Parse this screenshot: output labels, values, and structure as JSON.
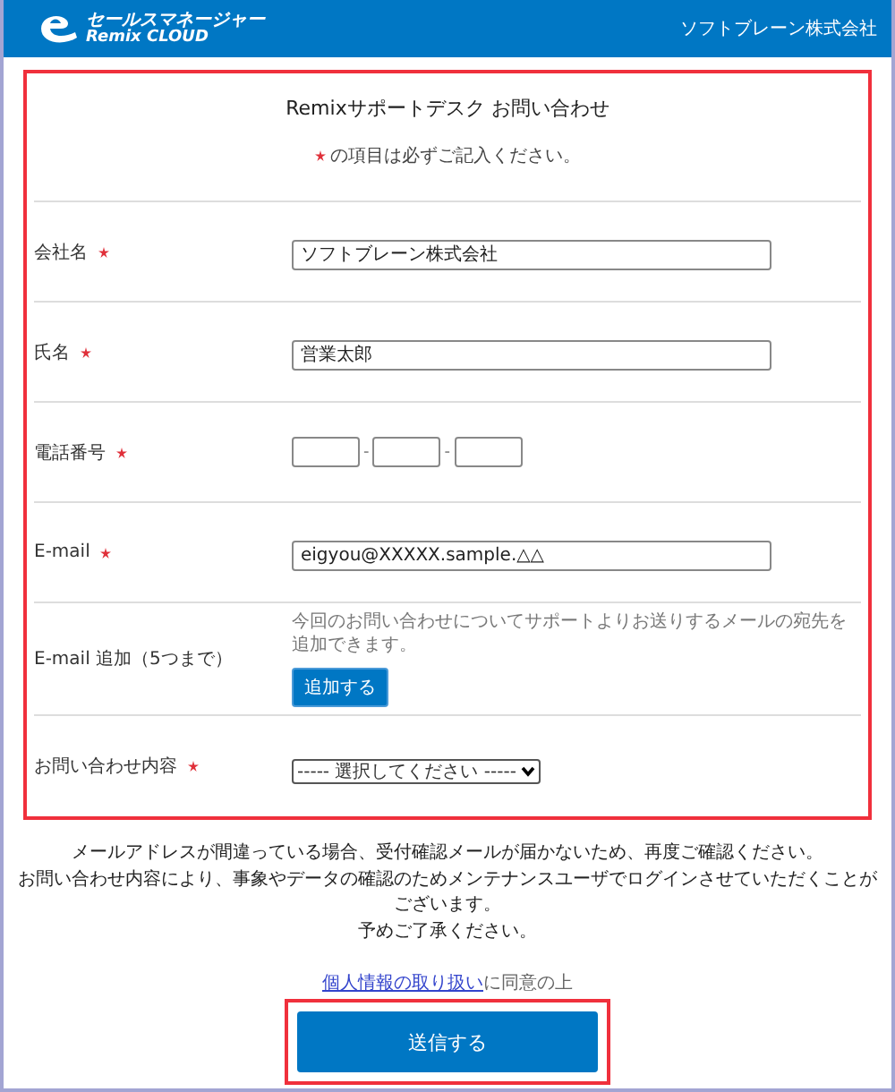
{
  "header": {
    "logo_top": "セールスマネージャー",
    "logo_bottom": "Remix CLOUD",
    "company": "ソフトブレーン株式会社"
  },
  "form": {
    "title": "Remixサポートデスク お問い合わせ",
    "required_note": "の項目は必ずご記入ください。",
    "fields": [
      {
        "kind": "text",
        "label": "会社名",
        "required": true,
        "value": "ソフトブレーン株式会社"
      },
      {
        "kind": "text",
        "label": "氏名",
        "required": true,
        "value": "営業太郎"
      },
      {
        "kind": "phone",
        "label": "電話番号",
        "required": true,
        "separators": [
          "-",
          "-"
        ]
      },
      {
        "kind": "text",
        "label": "E-mail",
        "required": true,
        "value": "eigyou@XXXXX.sample.△△"
      },
      {
        "kind": "add",
        "label": "E-mail 追加（5つまで）",
        "required": false,
        "note": "今回のお問い合わせについてサポートよりお送りするメールの宛先を追加できます。",
        "button": "追加する"
      },
      {
        "kind": "select",
        "label": "お問い合わせ内容",
        "required": true,
        "value": "----- 選択してください -----"
      }
    ]
  },
  "notice": [
    "メールアドレスが間違っている場合、受付確認メールが届かないため、再度ご確認ください。",
    "お問い合わせ内容により、事象やデータの確認のためメンテナンスユーザでログインさせていただくことがございます。",
    "予めご了承ください。"
  ],
  "consent": {
    "link": "個人情報の取り扱い",
    "text": "に同意の上"
  },
  "submit": "送信する"
}
